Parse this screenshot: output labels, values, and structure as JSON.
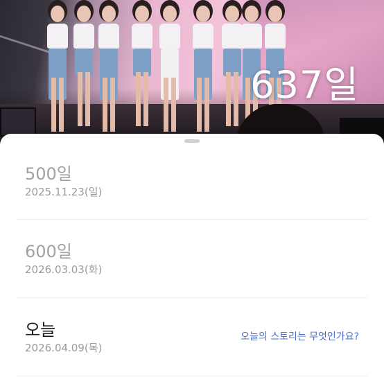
{
  "hero": {
    "day_count": "637일"
  },
  "milestones": [
    {
      "title": "500일",
      "date": "2025.11.23(일)"
    },
    {
      "title": "600일",
      "date": "2026.03.03(화)"
    },
    {
      "title": "오늘",
      "date": "2026.04.09(목)",
      "story_link": "오늘의 스토리는 무엇인가요?"
    }
  ],
  "colors": {
    "sheet_background": "#ffffff",
    "past_title": "#a0a0a6",
    "today_title": "#1c1c1e",
    "date_text": "#9a9aa0",
    "link": "#4a6fc7",
    "divider": "#ececef"
  }
}
